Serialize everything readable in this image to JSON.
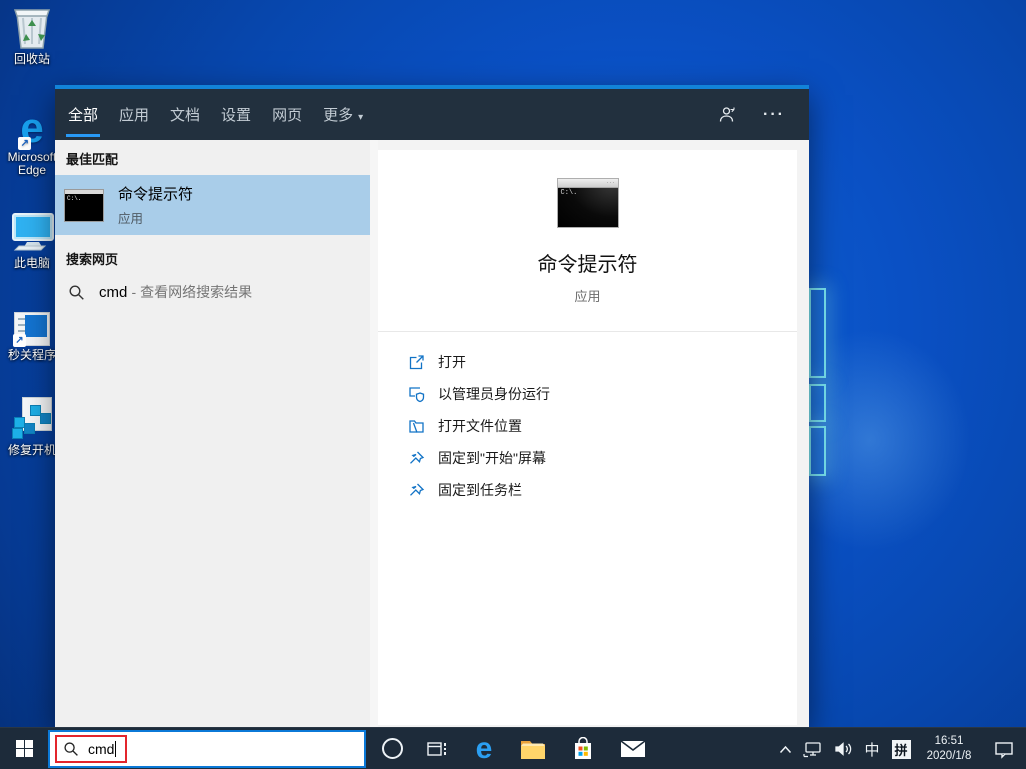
{
  "colors": {
    "accent_blue": "#0078d7",
    "selection_blue": "#a9cde9",
    "panel_header_bg": "#22303e",
    "taskbar_bg": "#1d2b3a",
    "annotation_red": "#e3252c",
    "wallpaper_blue": "#0a50c4",
    "action_icon_blue": "#1273c6"
  },
  "desktop": {
    "icons": [
      {
        "label": "回收站",
        "icon": "recycle-bin-icon"
      },
      {
        "label": "Microsoft Edge",
        "icon": "edge-icon"
      },
      {
        "label": "此电脑",
        "icon": "this-pc-monitor-icon"
      },
      {
        "label": "秒关程序",
        "icon": "app-window-shortcut-icon"
      },
      {
        "label": "修复开机",
        "icon": "blue-cubes-tool-icon"
      }
    ]
  },
  "search_panel": {
    "tabs": [
      {
        "label": "全部",
        "active": true
      },
      {
        "label": "应用",
        "active": false
      },
      {
        "label": "文档",
        "active": false
      },
      {
        "label": "设置",
        "active": false
      },
      {
        "label": "网页",
        "active": false
      },
      {
        "label": "更多",
        "active": false,
        "dropdown": true
      }
    ],
    "dropdown_glyph": "▾",
    "ellipsis_glyph": "···",
    "left": {
      "best_match_header": "最佳匹配",
      "best_match": {
        "title": "命令提示符",
        "type": "应用",
        "icon": "cmd-window-icon"
      },
      "web_header": "搜索网页",
      "web_result": {
        "query": "cmd",
        "suffix": "- 查看网络搜索结果",
        "icon": "search-icon"
      }
    },
    "right": {
      "app_title": "命令提示符",
      "app_type": "应用",
      "icon_prompt_text": "C:\\.",
      "icon_dots": "···",
      "actions": [
        {
          "label": "打开",
          "icon": "open-launch-icon"
        },
        {
          "label": "以管理员身份运行",
          "icon": "admin-shield-icon"
        },
        {
          "label": "打开文件位置",
          "icon": "folder-location-icon"
        },
        {
          "label": "固定到\"开始\"屏幕",
          "icon": "pin-icon"
        },
        {
          "label": "固定到任务栏",
          "icon": "pin-icon"
        }
      ]
    }
  },
  "taskbar": {
    "search_input": {
      "value": "cmd",
      "annotated_red_box": true
    },
    "tray": {
      "ime_lang": "中",
      "ime_mode": "拼",
      "time": "16:51",
      "date": "2020/1/8"
    }
  }
}
